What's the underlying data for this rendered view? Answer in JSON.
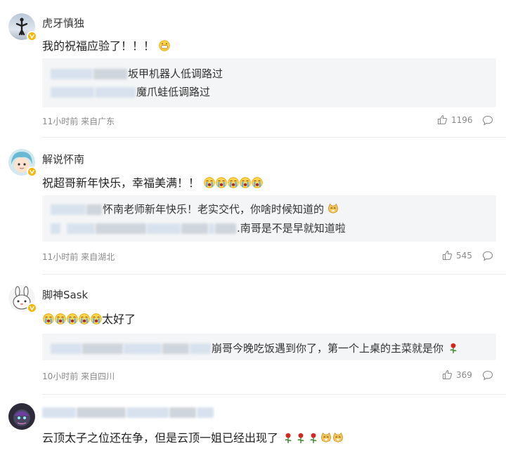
{
  "comments": [
    {
      "username": "虎牙慎独",
      "text": "我的祝福应验了！！！",
      "replies": [
        "坂甲机器人低调路过",
        "魔爪蛙低调路过"
      ],
      "meta": "11小时前 来自广东",
      "likes": "1196"
    },
    {
      "username": "解说怀南",
      "text": "祝超哥新年快乐，幸福美满！！",
      "replies": [
        "怀南老师新年快乐！老实交代，你啥时候知道的",
        ".南哥是不是早就知道啦"
      ],
      "meta": "11小时前 来自湖北",
      "likes": "545"
    },
    {
      "username": "脚神Sask",
      "text": "太好了",
      "replies": [
        "崩哥今晚吃饭遇到你了，第一个上桌的主菜就是你"
      ],
      "meta": "10小时前 来自四川",
      "likes": "369"
    },
    {
      "username": "",
      "text": "云顶太子之位还在争，但是云顶一姐已经出现了"
    }
  ],
  "icons": {
    "like": "thumbs-up-icon",
    "reply": "comment-bubble-icon",
    "verified": "verified-badge-icon",
    "emoji_laugh": "grin-emoji",
    "emoji_cry": "crying-emoji",
    "emoji_doge": "doge-emoji",
    "rose": "rose-emoji"
  },
  "colors": {
    "verified": "#f7b500",
    "meta": "#8a8a8a",
    "reply_bg": "#f4f5f6"
  }
}
